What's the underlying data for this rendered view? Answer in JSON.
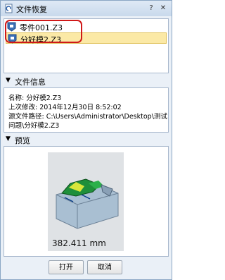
{
  "window": {
    "title": "文件恢复"
  },
  "file_list": {
    "items": [
      {
        "label": "零件001.Z3",
        "selected": false
      },
      {
        "label": "分好模2.Z3",
        "selected": true
      }
    ]
  },
  "file_info": {
    "header": "文件信息",
    "name_line": "名称: 分好模2.Z3",
    "modified_line": "上次修改: 2014年12月30日 8:52:02",
    "path_line1": "源文件路径: C:\\Users\\Administrator\\Desktop\\测试",
    "path_line2": "问题\\分好模2.Z3"
  },
  "preview": {
    "header": "预览",
    "measurement": "382.411 mm"
  },
  "buttons": {
    "open": "打开",
    "cancel": "取消"
  },
  "colors": {
    "highlight": "#d01818",
    "selected_bg": "#fbe9a6",
    "accent": "#2b5fa8"
  },
  "icons": [
    "recovery-icon",
    "help-icon",
    "close-icon",
    "z3-file-icon",
    "collapse-arrow-icon"
  ]
}
